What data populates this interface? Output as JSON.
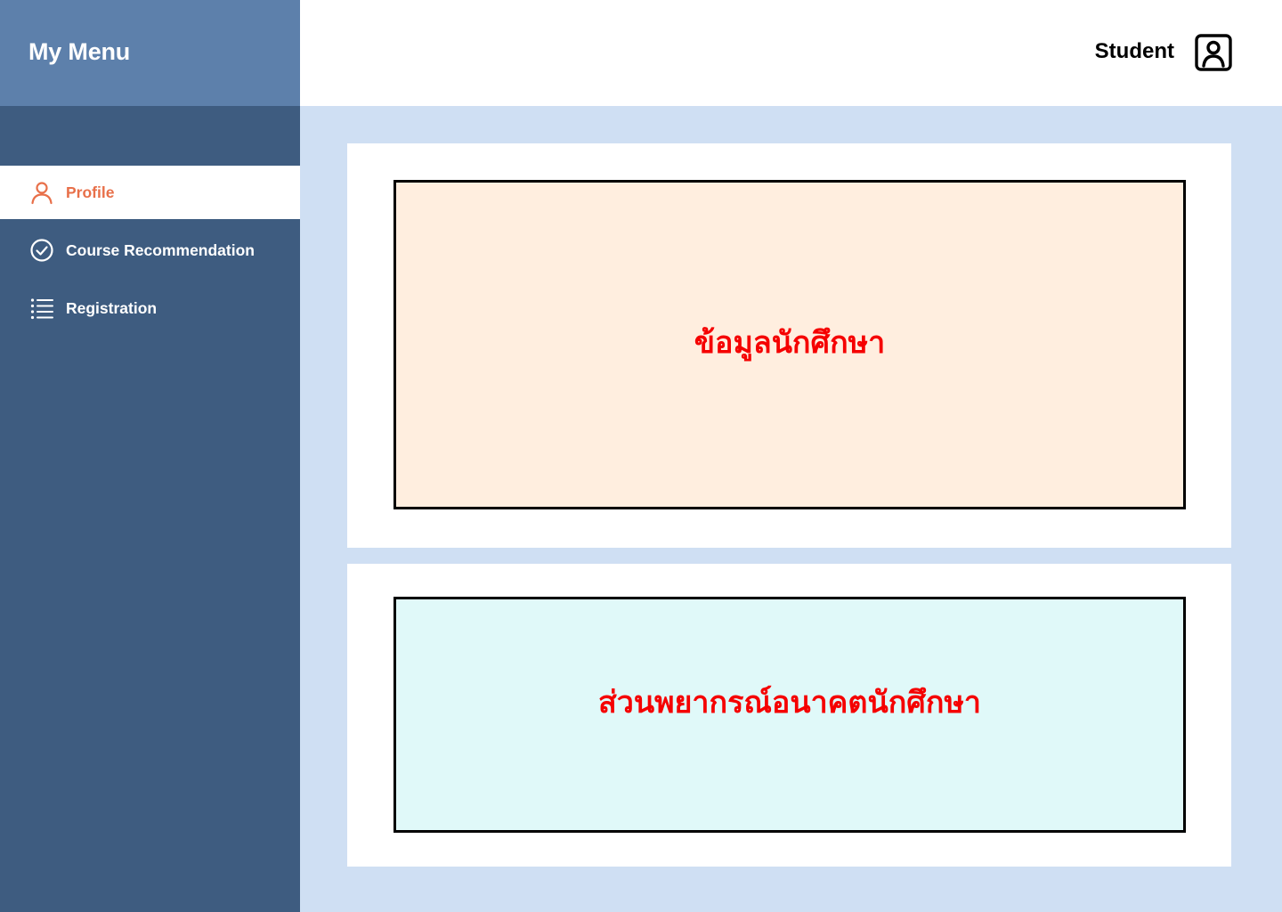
{
  "sidebar": {
    "title": "My Menu",
    "items": [
      {
        "label": "Profile",
        "icon": "user-icon",
        "active": true
      },
      {
        "label": "Course Recommendation",
        "icon": "check-circle-icon",
        "active": false
      },
      {
        "label": "Registration",
        "icon": "list-icon",
        "active": false
      }
    ]
  },
  "header": {
    "role": "Student",
    "account_icon": "account-square-icon"
  },
  "main": {
    "student_info_title": "ข้อมูลนักศึกษา",
    "student_forecast_title": "ส่วนพยากรณ์อนาคตนักศึกษา"
  },
  "colors": {
    "sidebar": "#3e5c80",
    "sidebar_header": "#5d80ab",
    "accent": "#e8704a",
    "content_bg": "#cfdff3",
    "info_box": "#ffeedf",
    "forecast_box": "#e0f9f9",
    "heading_red": "#f50000"
  }
}
